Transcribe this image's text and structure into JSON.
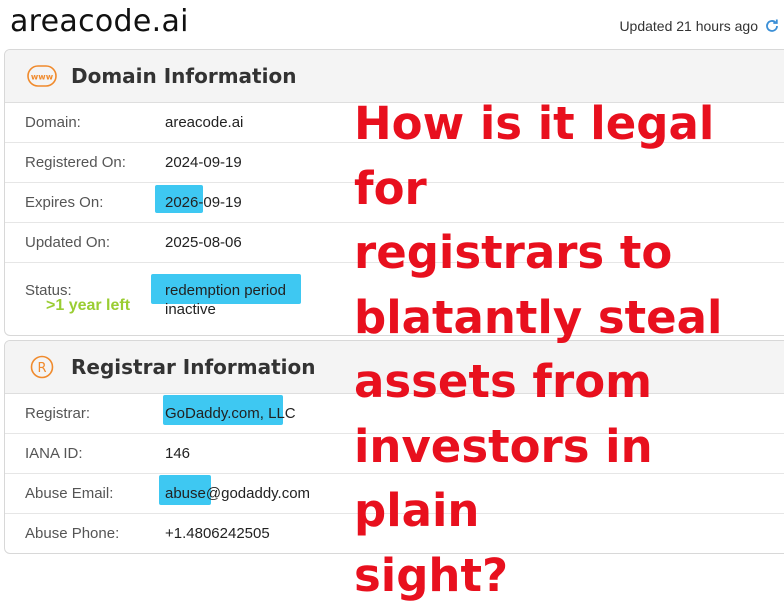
{
  "header": {
    "site_title": "areacode.ai",
    "updated_text": "Updated 21 hours ago",
    "refresh_icon": "refresh-icon"
  },
  "domain_card": {
    "title": "Domain Information",
    "icon": "www-icon",
    "rows": [
      {
        "label": "Domain:",
        "value": "areacode.ai"
      },
      {
        "label": "Registered On:",
        "value": "2024-09-19"
      },
      {
        "label": "Expires On:",
        "value_highlight": "2026",
        "value_rest": "-09-19"
      },
      {
        "label": "Updated On:",
        "value": "2025-08-06"
      },
      {
        "label": "Status:",
        "value": "redemption period",
        "value2": "inactive"
      }
    ]
  },
  "registrar_card": {
    "title": "Registrar Information",
    "icon": "registered-icon",
    "rows": [
      {
        "label": "Registrar:",
        "value": "GoDaddy.com, LLC"
      },
      {
        "label": "IANA ID:",
        "value": "146"
      },
      {
        "label": "Abuse Email:",
        "value_highlight": "abuse",
        "value_rest": "@godaddy.com"
      },
      {
        "label": "Abuse Phone:",
        "value": "+1.4806242505"
      }
    ]
  },
  "annotation": {
    "line1": "How is it legal for",
    "line2": "registrars to",
    "line3": "blatantly steal",
    "line4": "assets from",
    "line5": "investors in plain",
    "line6": "sight?",
    "year_left": ">1 year left"
  },
  "colors": {
    "highlight": "#3ec8f2",
    "annotation_red": "#e8101e",
    "annotation_green": "#9acd32",
    "icon_orange": "#f08a2c"
  }
}
